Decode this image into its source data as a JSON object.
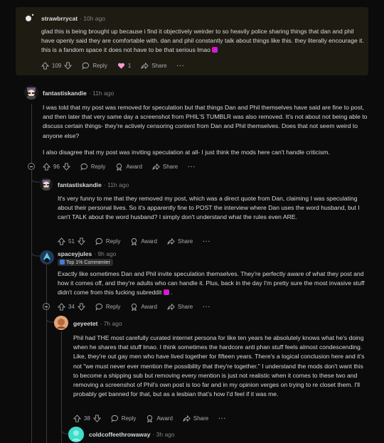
{
  "comments": [
    {
      "username": "strawbrrycat",
      "time": "10h ago",
      "body": [
        "glad this is being brought up because i find it objectively weirder to so heavily police sharing things that dan and phil have openly said they are comfortable with. dan and phil constantly talk about things like this. they literally encourage it. this is a fandom space it does not have to be that serious lmao"
      ],
      "votes": "109",
      "reply_label": "Reply",
      "award_count": "1",
      "share_label": "Share",
      "more_label": "···"
    },
    {
      "username": "fantastiskandie",
      "time": "11h ago",
      "body": [
        "I was told that my post was removed for speculation but that things Dan and Phil themselves have said are fine to post, and then later that very same day a screenshot from PHIL'S TUMBLR was also removed. It's not about not being able to discuss certain things- they're actively censoring content from Dan and Phil themselves. Does that not seem weird to anyone else?",
        "I also disagree that my post was inviting speculation at all- I just think the mods here can't handle criticism."
      ],
      "votes": "96",
      "reply_label": "Reply",
      "award_label": "Award",
      "share_label": "Share",
      "more_label": "···"
    },
    {
      "username": "fantastiskandie",
      "time": "11h ago",
      "body": [
        "It's very funny to me that they removed my post, which was a direct quote from Dan, claiming I was speculating about their personal lives. So it's apparently fine to POST the interview where Dan uses the word husband, but I can't TALK about the word husband? I simply don't understand what the rules even ARE."
      ],
      "votes": "51",
      "reply_label": "Reply",
      "award_label": "Award",
      "share_label": "Share",
      "more_label": "···"
    },
    {
      "username": "spaceyjules",
      "time": "9h ago",
      "flair": "Top 1% Commenter",
      "body": [
        "Exactly like sometimes Dan and Phil invite speculation themselves. They're perfectly aware of what they post and how it comes off, and they're adults who can handle it. Plus, back in the day I'm pretty sure the most invasive stuff didn't come from this fucking subreddit"
      ],
      "votes": "34",
      "reply_label": "Reply",
      "award_label": "Award",
      "share_label": "Share",
      "more_label": "···"
    },
    {
      "username": "geyeetet",
      "time": "7h ago",
      "body": [
        "Phil had THE most carefully curated internet persona for like ten years he absolutely knows what he's doing when he shares that stuff lmao. I think sometimes the hardcore anti phan stuff feels almost condescending. Like, they're out gay men who have lived together for fifteen years. There's a logical conclusion here and it's not \"we must never ever mention the possibility that they're together.\" I understand the mods don't want this to become a shipping sub but removing every mention is just not realistic when it comes to these two and removing a screenshot of Phil's own post is too far and in my opinion verges on trying to re closet them. I'll probably get banned for that, but as a lesbian that's how I'd feel if it was me."
      ],
      "votes": "38",
      "reply_label": "Reply",
      "award_label": "Award",
      "share_label": "Share",
      "more_label": "···"
    },
    {
      "username": "coldcoffeethrowaway",
      "time": "3h ago"
    }
  ]
}
